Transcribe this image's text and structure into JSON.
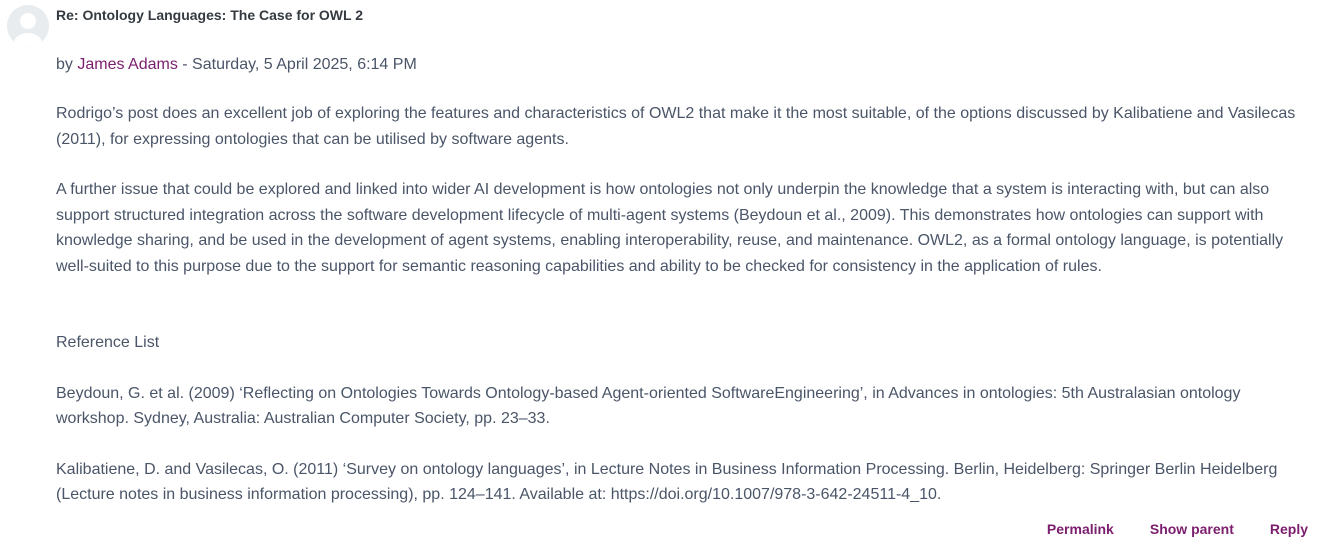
{
  "post": {
    "subject": "Re: Ontology Languages: The Case for OWL 2",
    "by_prefix": "by ",
    "author": "James Adams",
    "date_separator": " - ",
    "date": "Saturday, 5 April 2025, 6:14 PM",
    "paragraphs": [
      "Rodrigo’s post does an excellent job of exploring the features and characteristics of OWL2 that make it the most suitable, of the options discussed by Kalibatiene and Vasilecas (2011), for expressing ontologies that can be utilised by software agents.",
      "A further issue that could be explored and linked into wider AI development is how ontologies not only underpin the knowledge that a system is interacting with, but can also support structured integration across the software development lifecycle of multi-agent systems (Beydoun et al., 2009). This demonstrates how ontologies can support with knowledge sharing, and be used in the development of agent systems, enabling interoperability, reuse, and maintenance. OWL2, as a formal ontology language, is potentially well-suited to this purpose due to the support for semantic reasoning capabilities and ability to be checked for consistency in the application of rules.",
      "Reference List",
      "Beydoun, G. et al. (2009) ‘Reflecting on Ontologies Towards Ontology-based Agent-oriented SoftwareEngineering’, in Advances in ontologies: 5th Australasian ontology workshop. Sydney, Australia: Australian Computer Society, pp. 23–33.",
      "Kalibatiene, D. and Vasilecas, O. (2011) ‘Survey on ontology languages’, in Lecture Notes in Business Information Processing. Berlin, Heidelberg: Springer Berlin Heidelberg (Lecture notes in business information processing), pp. 124–141. Available at: https://doi.org/10.1007/978-3-642-24511-4_10."
    ],
    "actions": {
      "permalink": "Permalink",
      "show_parent": "Show parent",
      "reply": "Reply"
    }
  },
  "colors": {
    "link": "#7a1e6d",
    "text": "#4a5568",
    "heading": "#343a40",
    "avatar_bg": "#e9ecef"
  },
  "icons": {
    "avatar": "user-avatar-icon"
  }
}
